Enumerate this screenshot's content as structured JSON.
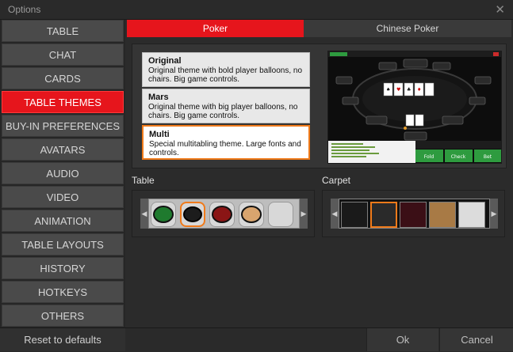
{
  "window": {
    "title": "Options"
  },
  "sidebar": {
    "items": [
      {
        "label": "TABLE",
        "active": false
      },
      {
        "label": "CHAT",
        "active": false
      },
      {
        "label": "CARDS",
        "active": false
      },
      {
        "label": "TABLE THEMES",
        "active": true
      },
      {
        "label": "BUY-IN PREFERENCES",
        "active": false
      },
      {
        "label": "AVATARS",
        "active": false
      },
      {
        "label": "AUDIO",
        "active": false
      },
      {
        "label": "VIDEO",
        "active": false
      },
      {
        "label": "ANIMATION",
        "active": false
      },
      {
        "label": "TABLE LAYOUTS",
        "active": false
      },
      {
        "label": "HISTORY",
        "active": false
      },
      {
        "label": "HOTKEYS",
        "active": false
      },
      {
        "label": "OTHERS",
        "active": false
      }
    ],
    "reset_label": "Reset to defaults"
  },
  "tabs": [
    {
      "label": "Poker",
      "active": true
    },
    {
      "label": "Chinese Poker",
      "active": false
    }
  ],
  "themes": [
    {
      "name": "Original",
      "desc": "Original theme with bold player balloons, no chairs. Big game controls.",
      "selected": false
    },
    {
      "name": "Mars",
      "desc": "Original theme with big player balloons, no chairs. Big game controls.",
      "selected": false
    },
    {
      "name": "Multi",
      "desc": "Special multitabling theme. Large fonts and controls.",
      "selected": true
    }
  ],
  "preview": {
    "buttons": [
      "Fold",
      "Check",
      "Bet"
    ]
  },
  "sections": {
    "table_label": "Table",
    "carpet_label": "Carpet"
  },
  "table_swatches": [
    {
      "color": "#1f7a2e",
      "selected": false
    },
    {
      "color": "#1c1c1c",
      "selected": true
    },
    {
      "color": "#8a1515",
      "selected": false
    },
    {
      "color": "#d8a46e",
      "selected": false
    },
    {
      "color": "#d8d8d8",
      "selected": false
    }
  ],
  "carpet_swatches": [
    {
      "color": "#1a1a1a",
      "selected": false
    },
    {
      "color": "#2a2a2a",
      "selected": true
    },
    {
      "color": "#3b0f16",
      "selected": false
    },
    {
      "color": "#a87a45",
      "selected": false
    },
    {
      "color": "#dcdcdc",
      "selected": false
    }
  ],
  "footer": {
    "ok_label": "Ok",
    "cancel_label": "Cancel"
  },
  "colors": {
    "accent": "#e6151c",
    "selection": "#f07a1a",
    "background": "#2b2b2b"
  }
}
